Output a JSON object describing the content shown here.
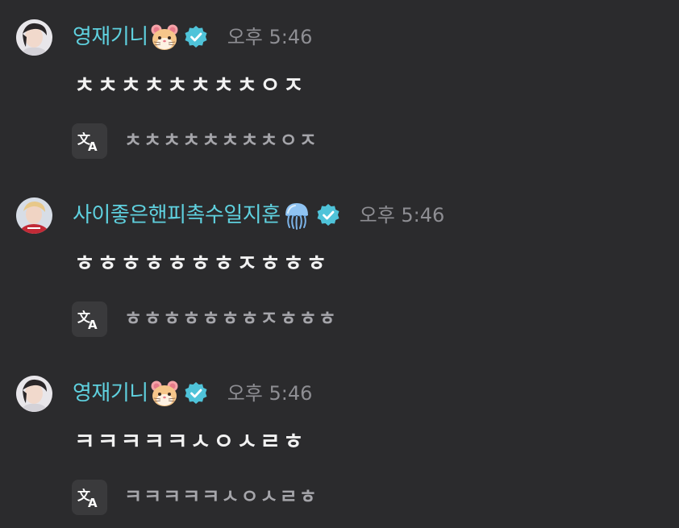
{
  "messages": [
    {
      "author": "영재기니",
      "author_emoji": "hamster-face-emoji",
      "verified_icon": "verified-badge-icon",
      "time": "오후 5:46",
      "text": "ㅊㅊㅊㅊㅊㅊㅊㅊㅇㅈ",
      "translation_icon": "translate-icon",
      "translation": "ㅊㅊㅊㅊㅊㅊㅊㅊㅇㅈ"
    },
    {
      "author": "사이좋은핸피촉수일지훈",
      "author_emoji": "jellyfish-emoji",
      "verified_icon": "verified-badge-icon",
      "time": "오후 5:46",
      "text": "ㅎㅎㅎㅎㅎㅎㅎㅈㅎㅎㅎ",
      "translation_icon": "translate-icon",
      "translation": "ㅎㅎㅎㅎㅎㅎㅎㅈㅎㅎㅎ"
    },
    {
      "author": "영재기니",
      "author_emoji": "hamster-face-emoji",
      "verified_icon": "verified-badge-icon",
      "time": "오후 5:46",
      "text": "ㅋㅋㅋㅋㅋㅅㅇㅅㄹㅎ",
      "translation_icon": "translate-icon",
      "translation": "ㅋㅋㅋㅋㅋㅅㅇㅅㄹㅎ"
    }
  ],
  "colors": {
    "background": "#2b2b2d",
    "author": "#5fd1df",
    "timestamp": "#8e8e93",
    "message_text": "#f2f2f2",
    "translation_text": "#a5a5aa",
    "verified_badge": "#4fc3d9"
  }
}
